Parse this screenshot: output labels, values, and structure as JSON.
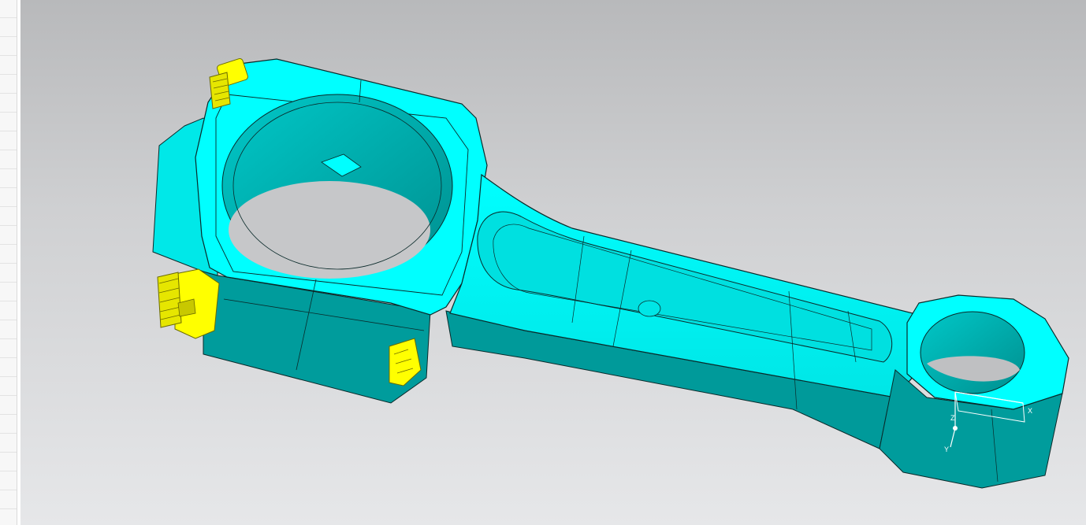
{
  "app": {
    "view": "graphics-window"
  },
  "model": {
    "part": "connecting-rod",
    "body_color": "#00ffff",
    "body_shade_color": "#00a8a8",
    "fastener_color": "#ffff00",
    "edge_color": "#0a2a2a"
  },
  "triad": {
    "axis_x_label": "X",
    "axis_y_label": "Y",
    "axis_z_label": "Z"
  },
  "background": {
    "top_color": "#b8b9bb",
    "bottom_color": "#e6e7e9"
  }
}
